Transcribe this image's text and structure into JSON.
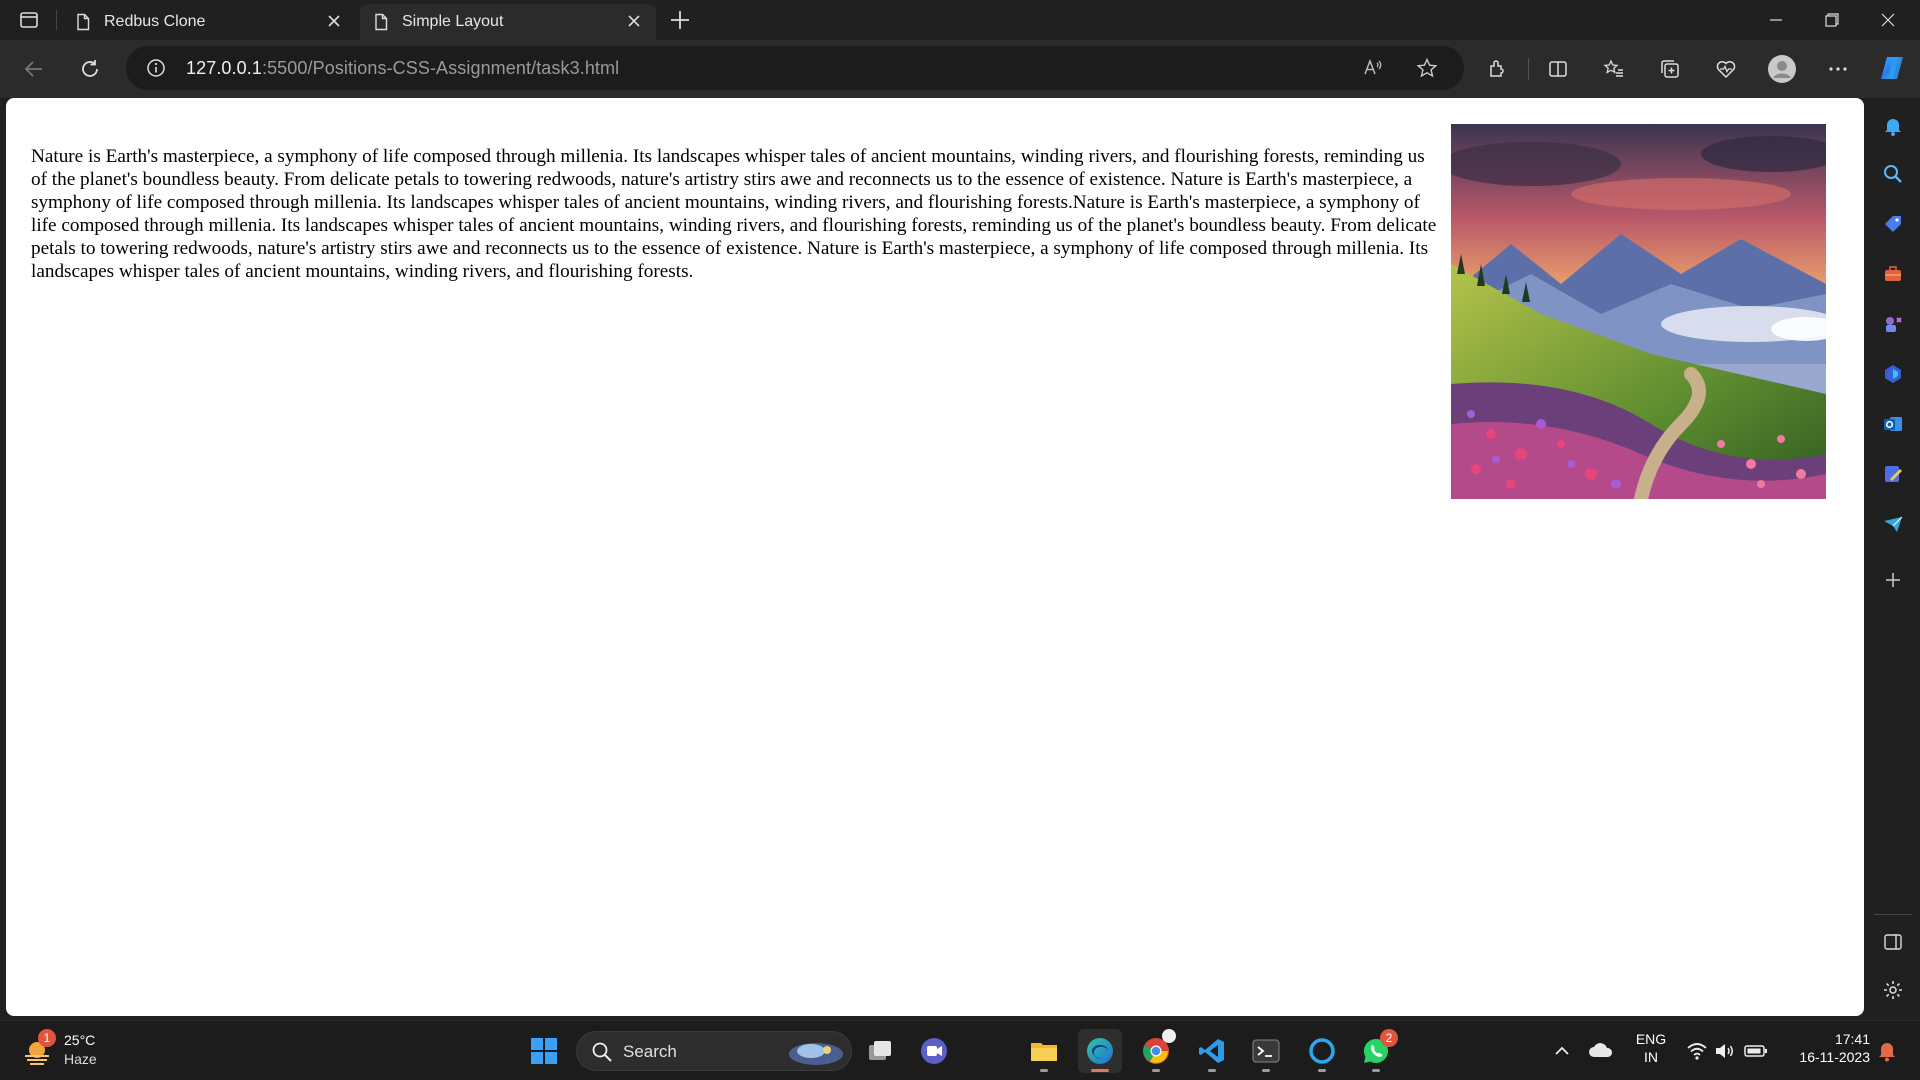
{
  "browser": {
    "tabs": [
      {
        "title": "Redbus Clone",
        "active": false
      },
      {
        "title": "Simple Layout",
        "active": true
      }
    ],
    "url": {
      "host": "127.0.0.1",
      "path": ":5500/Positions-CSS-Assignment/task3.html"
    },
    "read_aloud_label": "A̩"
  },
  "page": {
    "paragraph": "Nature is Earth's masterpiece, a symphony of life composed through millenia. Its landscapes whisper tales of ancient mountains, winding rivers, and flourishing forests, reminding us of the planet's boundless beauty. From delicate petals to towering redwoods, nature's artistry stirs awe and reconnects us to the essence of existence. Nature is Earth's masterpiece, a symphony of life composed through millenia. Its landscapes whisper tales of ancient mountains, winding rivers, and flourishing forests.Nature is Earth's masterpiece, a symphony of life composed through millenia. Its landscapes whisper tales of ancient mountains, winding rivers, and flourishing forests, reminding us of the planet's boundless beauty. From delicate petals to towering redwoods, nature's artistry stirs awe and reconnects us to the essence of existence. Nature is Earth's masterpiece, a symphony of life composed through millenia. Its landscapes whisper tales of ancient mountains, winding rivers, and flourishing forests."
  },
  "taskbar": {
    "weather": {
      "temp": "25°C",
      "condition": "Haze",
      "badge": "1"
    },
    "search_label": "Search",
    "whatsapp_badge": "2",
    "language": {
      "line1": "ENG",
      "line2": "IN"
    },
    "clock": {
      "time": "17:41",
      "date": "16-11-2023"
    }
  },
  "colors": {
    "chrome_dark": "#202020",
    "toolbar": "#2b2b2b",
    "page_bg": "#ffffff",
    "taskbar": "#1c1c1c"
  }
}
